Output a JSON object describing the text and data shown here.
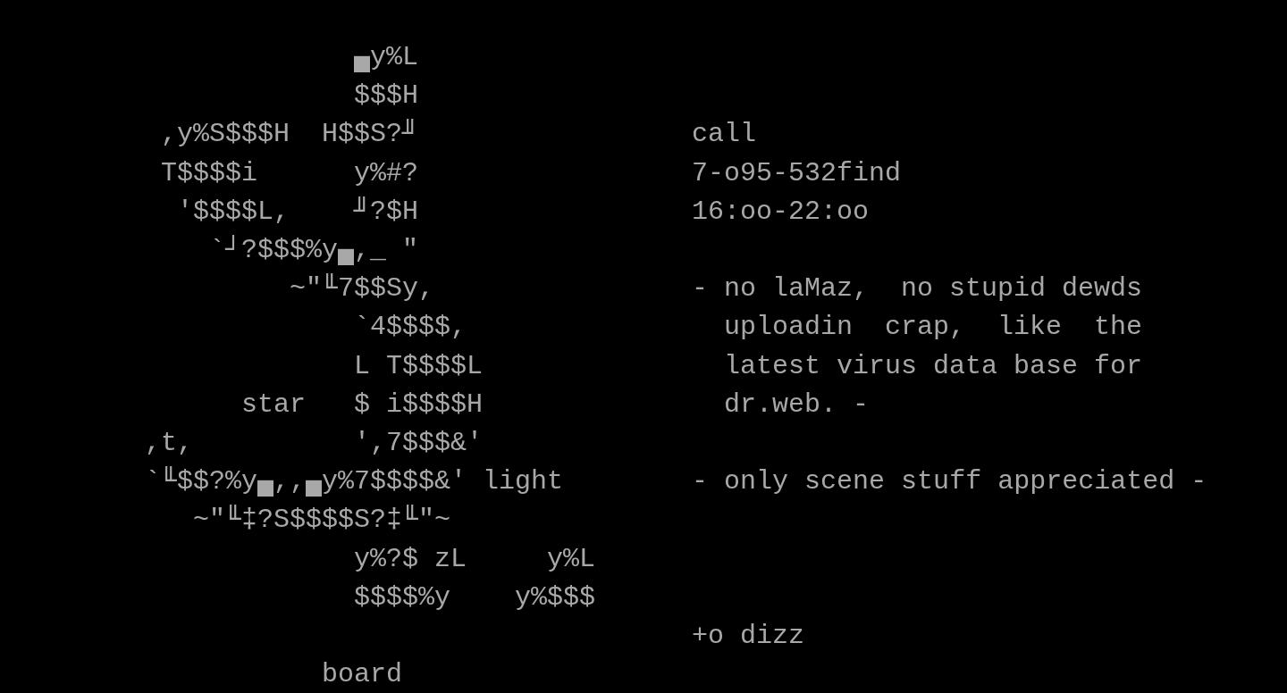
{
  "screen": {
    "lines": [
      {
        "left": [
          "▄y%L"
        ]
      },
      {
        "left": [
          "$$$H"
        ]
      },
      {
        "left": [
          ",y%S$$$H",
          "H$$S?╜"
        ],
        "right": "call"
      },
      {
        "left": [
          "T$$$$i",
          "y%#?"
        ],
        "right": "7-o95-532find"
      },
      {
        "left": [
          "'$$$$L,",
          "╜?$H"
        ],
        "right": "16:oo-22:oo"
      },
      {
        "left": [
          "`┘?$$$%y▄,_ \""
        ]
      },
      {
        "left": [
          "~\"╙7$$Sy,"
        ],
        "right": "- no laMaz,  no stupid dewds"
      },
      {
        "left": [
          "`4$$$$,"
        ],
        "right": "uploadin  crap,  like  the"
      },
      {
        "left": [
          "L T$$$$L"
        ],
        "right": "latest virus data base for"
      },
      {
        "left": [
          "star",
          "$ i$$$$H"
        ],
        "right": "dr.web. -"
      },
      {
        "left": [
          ",t,",
          "',7$$$&'"
        ]
      },
      {
        "left": [
          "`╙$$?%y▄,,▄y%7$$$$&'",
          "light"
        ],
        "right": "- only scene stuff appreciated -"
      },
      {
        "left": [
          "~\"╙‡?S$$$$S?‡╙\"~"
        ]
      },
      {
        "left": [
          "y%?$ zL",
          "y%L"
        ]
      },
      {
        "left": [
          "$$$$%y",
          "y%$$$"
        ]
      },
      {
        "right": "+o dizz"
      },
      {
        "left": [
          "board"
        ]
      }
    ]
  }
}
